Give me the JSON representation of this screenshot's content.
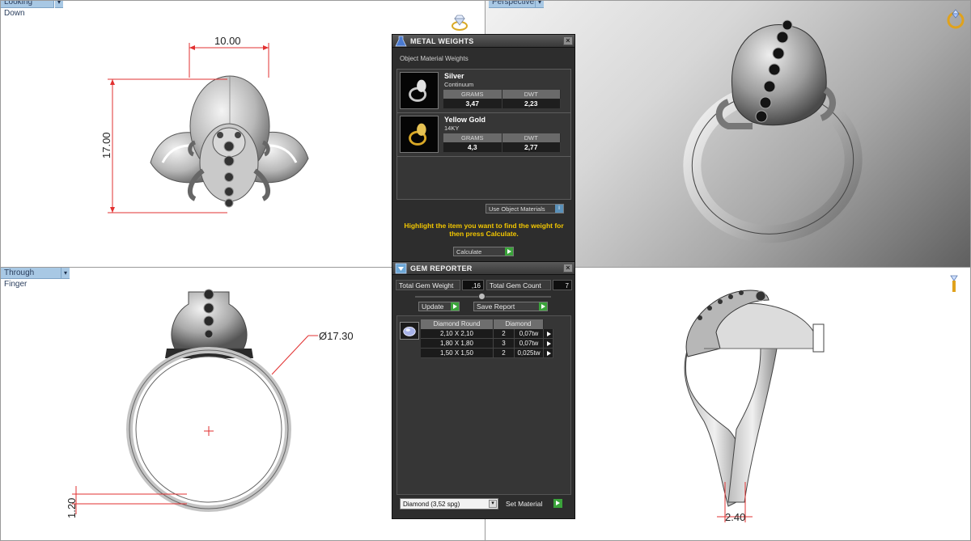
{
  "viewports": {
    "top_left": {
      "label": "Looking Down"
    },
    "top_right": {
      "label": "Perspective"
    },
    "bottom_left": {
      "label": "Through Finger"
    },
    "bottom_right": {
      "label": ""
    }
  },
  "dimensions": {
    "width_top": "10.00",
    "height_left": "17.00",
    "ring_diameter": "Ø17.30",
    "band_thickness": "1.20",
    "shank_width": "2.40"
  },
  "metal_weights": {
    "title": "METAL WEIGHTS",
    "subtitle": "Object Material Weights",
    "items": [
      {
        "name": "Silver",
        "alloy": "Continuum",
        "grams_label": "GRAMS",
        "dwt_label": "DWT",
        "grams": "3,47",
        "dwt": "2,23"
      },
      {
        "name": "Yellow Gold",
        "alloy": "14KY",
        "grams_label": "GRAMS",
        "dwt_label": "DWT",
        "grams": "4,3",
        "dwt": "2,77"
      }
    ],
    "use_object_materials": "Use Object Materials",
    "info_icon": "i",
    "help_text": "Highlight the item you want to find the weight for then press Calculate.",
    "calculate_label": "Calculate",
    "close_label": "×"
  },
  "gem_reporter": {
    "title": "GEM REPORTER",
    "total_weight_label": "Total Gem Weight",
    "total_weight_value": ",16",
    "total_count_label": "Total Gem Count",
    "total_count_value": "7",
    "update_label": "Update",
    "save_report_label": "Save Report",
    "table": {
      "headers": [
        "Diamond Round",
        "Diamond"
      ],
      "rows": [
        {
          "size": "2,10 X 2,10",
          "count": "2",
          "weight": "0,07tw"
        },
        {
          "size": "1,80 X 1,80",
          "count": "3",
          "weight": "0,07tw"
        },
        {
          "size": "1,50 X 1,50",
          "count": "2",
          "weight": "0,025tw"
        }
      ]
    },
    "material_select": "Diamond     (3,52 spg)",
    "set_material_label": "Set Material",
    "close_label": "×"
  },
  "colors": {
    "panel_bg": "#2d2d2d",
    "accent_yellow": "#f2c600",
    "go_green": "#3aa33a",
    "dim_red": "#e23030",
    "viewport_label_bg": "#a8c8e4"
  },
  "icons": {
    "view_icons": [
      "diamond-ring-view-icon",
      "gold-ring-view-icon",
      "ring-side-view-icon"
    ],
    "panel_icons": [
      "metal-weights-flask-icon",
      "gem-reporter-icon"
    ]
  }
}
